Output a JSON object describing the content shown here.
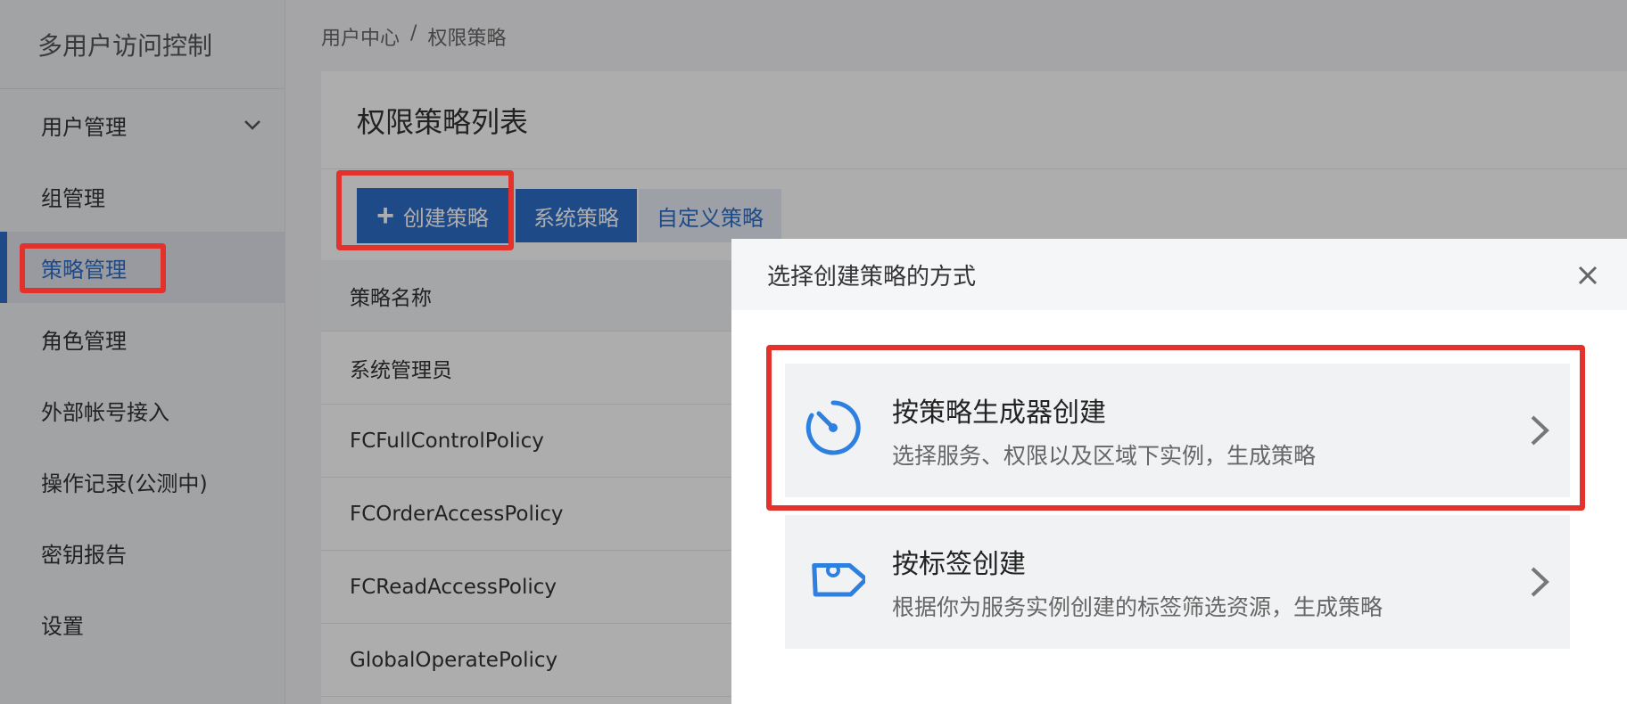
{
  "sidebar": {
    "title": "多用户访问控制",
    "items": [
      {
        "label": "用户管理"
      },
      {
        "label": "组管理"
      },
      {
        "label": "策略管理"
      },
      {
        "label": "角色管理"
      },
      {
        "label": "外部帐号接入"
      },
      {
        "label": "操作记录(公测中)"
      },
      {
        "label": "密钥报告"
      },
      {
        "label": "设置"
      }
    ],
    "active_index": 2
  },
  "breadcrumb": {
    "root": "用户中心",
    "separator": "/",
    "current": "权限策略"
  },
  "panel": {
    "title": "权限策略列表"
  },
  "toolbar": {
    "create_label": "创建策略",
    "tab_system": "系统策略",
    "tab_custom": "自定义策略"
  },
  "table": {
    "header": "策略名称",
    "rows": [
      "系统管理员",
      "FCFullControlPolicy",
      "FCOrderAccessPolicy",
      "FCReadAccessPolicy",
      "GlobalOperatePolicy"
    ]
  },
  "modal": {
    "title": "选择创建策略的方式",
    "options": [
      {
        "title": "按策略生成器创建",
        "desc": "选择服务、权限以及区域下实例，生成策略",
        "icon": "timer-icon"
      },
      {
        "title": "按标签创建",
        "desc": "根据你为服务实例创建的标签筛选资源，生成策略",
        "icon": "tag-icon"
      }
    ]
  },
  "colors": {
    "primary": "#2d6fc9",
    "highlight": "#e2322b"
  }
}
